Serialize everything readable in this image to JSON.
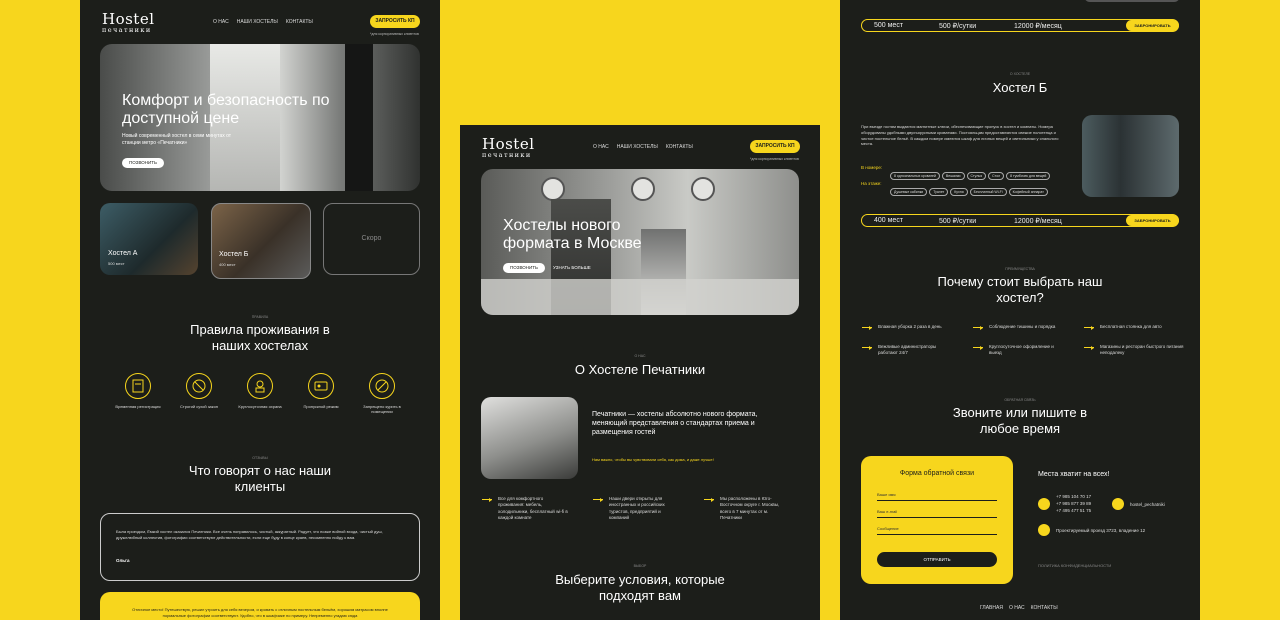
{
  "brand": {
    "name_top": "Hostel",
    "name_bottom": "печатники"
  },
  "nav": {
    "about": "О НАС",
    "hostels": "НАШИ ХОСТЕЛЫ",
    "contacts": "КОНТАКТЫ"
  },
  "cta": {
    "request": "ЗАПРОСИТЬ КП",
    "request_note": "*для корпоративных клиентов"
  },
  "p1": {
    "hero_title": "Комфорт и безопасность по доступной цене",
    "hero_text": "Новый современный хостел в семи минутах от станции метро «Печатники»",
    "call_button": "ПОЗВОНИТЬ",
    "cards": [
      {
        "name": "Хостел А",
        "places": "500 мест"
      },
      {
        "name": "Хостел Б",
        "places": "400 мест"
      },
      {
        "name": "Скоро",
        "places": ""
      }
    ],
    "rules_kicker": "ПРАВИЛА",
    "rules_title": "Правила проживания в наших хостелах",
    "rules": [
      "Временная регистрация",
      "Строгий сухой закон",
      "Круглосуточная охрана",
      "Пропускной режим",
      "Запрещено курить в помещении"
    ],
    "reviews_kicker": "ОТЗЫВЫ",
    "reviews_title": "Что говорят о нас наши клиенты",
    "review1_text": "Была проездом, Ёмкий хостел оказался Печатники. Все очень понравилось, чистый, аккуратный. Радует, что позже войной входа, чистый душ, дружелюбный коллектив, фотографии соответствуют действительности, если еще буду в конце краев, несомненно пойду к вам.",
    "review1_author": "Ольга",
    "review2_text": "Отличное место! Путешествую, решил утроить для себя вечером, и кровать с отличным постельным бельём, хорошим матрасом вполне нормальные фотографии соответствуют. Удобно, что в шкафчике по примеру. Непременно угадаю сюда"
  },
  "p2": {
    "hero_title": "Хостелы нового формата в Москве",
    "call_button": "ПОЗВОНИТЬ",
    "more_link": "УЗНАТЬ БОЛЬШЕ",
    "about_kicker": "О НАС",
    "about_title": "О Хостеле Печатники",
    "about_text": "Печатники — хостелы абсолютно нового формата, меняющий представления о стандартах приема и размещения гостей",
    "about_note": "Нам важно, чтобы вы чувствовали себя, как дома, и даже лучше!",
    "features": [
      "Все для комфортного проживания: мебель, холодильники, бесплатный wi-fi в каждой комнате",
      "Наши двери открыты для иностранных и российских туристов, предприятий и компаний",
      "Мы расположены в Юго-Восточном округе г. Москвы, всего в 7 минутах от м. Печатники"
    ],
    "choose_kicker": "ВЫБОР",
    "choose_title": "Выберите условия, которые подходят вам"
  },
  "p3": {
    "row1": {
      "places": "500 мест",
      "day": "500 ₽/сутки",
      "month": "12000 ₽/месяц",
      "book": "ЗАБРОНИРОВАТЬ"
    },
    "hostel_kicker": "О ХОСТЕЛЕ",
    "hostel_title": "Хостел Б",
    "hostel_text": "При въезде гостям выдаются магнитные ключи, обеспечивающие пропуск в хостел и комнаты. Номера оборудованы удобными двухъярусными кроватями. Постояльцам предоставляются свежие полотенца и чистое постельное бельё. В каждом номере имеются шкаф для личных вещей и светильники у спального места.",
    "in_room_label": "В номере:",
    "in_room": [
      "8 односпальных кроватей",
      "Вешалки",
      "Стулья",
      "Стол",
      "8 тумбочек для вещей"
    ],
    "on_floor_label": "На этаже:",
    "on_floor": [
      "Душевые кабинки",
      "Туалет",
      "Кухня",
      "Бесплатный Wi-Fi",
      "Кофейный аппарат"
    ],
    "row2": {
      "places": "400 мест",
      "day": "500 ₽/сутки",
      "month": "12000 ₽/месяц",
      "book": "ЗАБРОНИРОВАТЬ"
    },
    "why_kicker": "ПРЕИМУЩЕСТВА",
    "why_title": "Почему стоит выбрать наш хостел?",
    "why": [
      "Влажная уборка 2 раза в день",
      "Соблюдение тишины и порядка",
      "Бесплатная стоянка для авто",
      "Вежливые администраторы работают 24/7",
      "Круглосуточное оформление и выезд",
      "Магазины и ресторан быстрого питания неподалеку"
    ],
    "call_kicker": "ОБРАТНАЯ СВЯЗЬ",
    "call_title": "Звоните или пишите в любое время",
    "form_title": "Форма обратной связи",
    "form_name": "Ваше имя",
    "form_email": "Ваш e-mail",
    "form_msg": "Сообщение",
    "form_submit": "ОТПРАВИТЬ",
    "places_title": "Места хватит на всех!",
    "phones": "+7 985 104 70 17\n+7 985 877 39 89\n+7 495 477 51 75",
    "instagram": "hostel_pechatniki",
    "address": "Проектируемый проезд 3723, владение 12",
    "privacy": "ПОЛИТИКА КОНФИДЕНЦИАЛЬНОСТИ",
    "footer": [
      "ГЛАВНАЯ",
      "О НАС",
      "КОНТАКТЫ"
    ]
  }
}
